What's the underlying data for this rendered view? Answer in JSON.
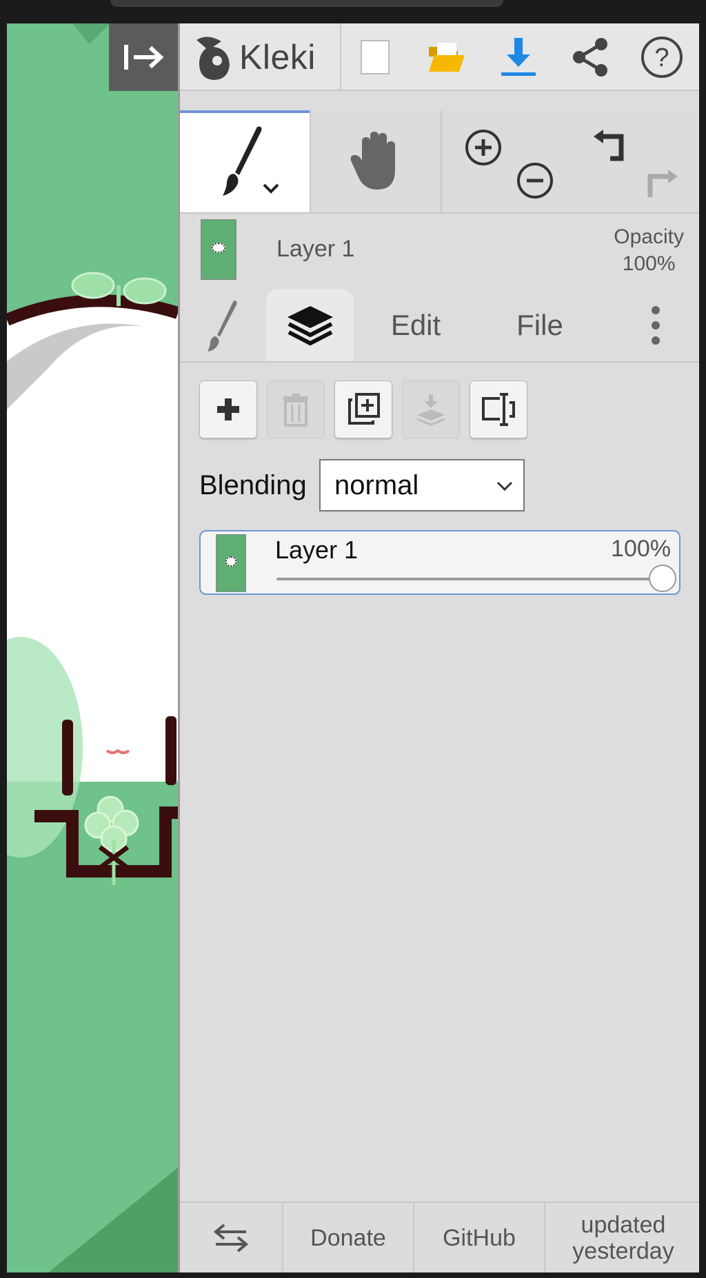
{
  "app": {
    "name": "Kleki"
  },
  "colors": {
    "accent": "#6e96d6",
    "canvas_green": "#6ec28a",
    "download_blue": "#1e88e5",
    "folder_yellow": "#f6b800"
  },
  "toolbar": {
    "icons": [
      "new-image-icon",
      "open-folder-icon",
      "download-icon",
      "share-icon",
      "help-icon"
    ]
  },
  "tools": {
    "items": [
      "brush-tool-icon",
      "hand-tool-icon",
      "zoom-in-icon",
      "zoom-out-icon",
      "undo-icon",
      "redo-icon"
    ]
  },
  "layer_info": {
    "name": "Layer 1",
    "opacity_label": "Opacity",
    "opacity_value": "100%"
  },
  "tabs": [
    {
      "id": "brush",
      "icon": "brush-icon"
    },
    {
      "id": "layers",
      "icon": "layers-icon",
      "active": true
    },
    {
      "id": "edit",
      "label": "Edit"
    },
    {
      "id": "file",
      "label": "File"
    },
    {
      "id": "more",
      "icon": "more-vertical-icon"
    }
  ],
  "layer_buttons": [
    "add-layer-icon",
    "delete-layer-icon",
    "duplicate-layer-icon",
    "merge-down-icon",
    "rename-layer-icon"
  ],
  "blending": {
    "label": "Blending",
    "value": "normal"
  },
  "layers": [
    {
      "name": "Layer 1",
      "opacity": "100%",
      "opacity_fraction": 1.0
    }
  ],
  "footer": {
    "swap_icon": "swap-side-icon",
    "donate": "Donate",
    "github": "GitHub",
    "updated_line1": "updated",
    "updated_line2": "yesterday"
  }
}
